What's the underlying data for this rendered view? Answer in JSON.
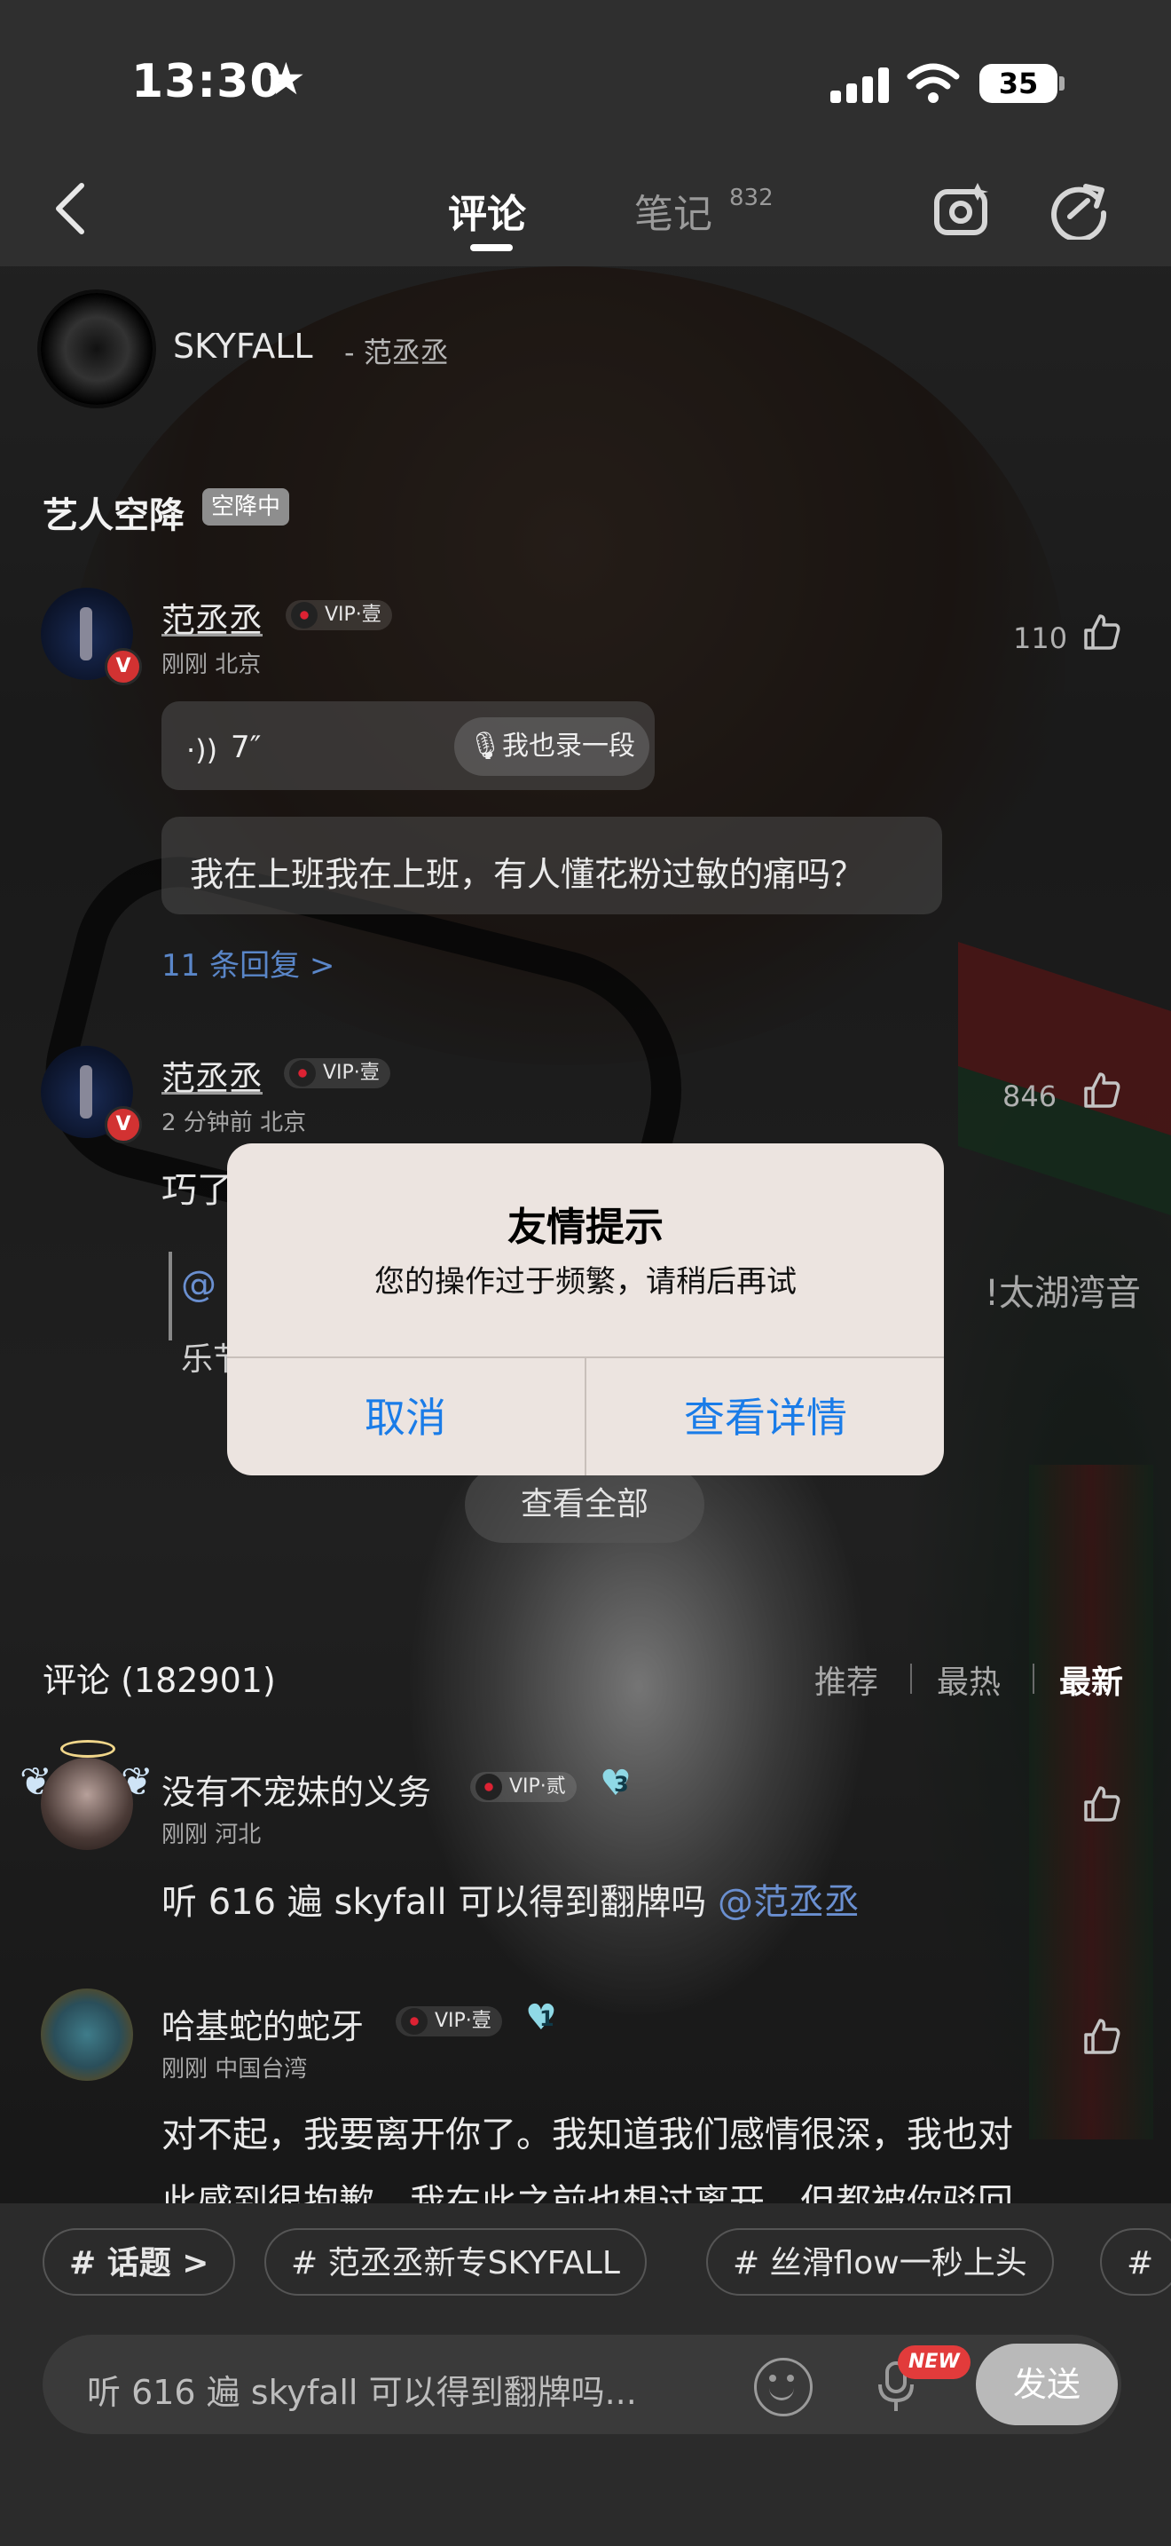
{
  "status": {
    "time": "13:30",
    "battery": "35"
  },
  "header": {
    "tabs": [
      {
        "label": "评论"
      },
      {
        "label": "笔记"
      }
    ],
    "notes_count": "832"
  },
  "song": {
    "title": "SKYFALL",
    "artist": "- 范丞丞"
  },
  "artist_section": {
    "label": "艺人空降",
    "badge": "空降中"
  },
  "artist_comments": [
    {
      "user": "范丞丞",
      "vip": "VIP·壹",
      "meta": "刚刚 北京",
      "likes": "110",
      "voice_duration": "7″",
      "record_label": "我也录一段",
      "text": "我在上班我在上班，有人懂花粉过敏的痛吗？",
      "replies": "11 条回复 >"
    },
    {
      "user": "范丞丞",
      "vip": "VIP·壹",
      "meta": "2 分钟前 北京",
      "likes": "846",
      "text_partial": "巧了",
      "reply_at_partial": "@",
      "reply_tail_partial": "乐节",
      "reply_right_partial": "!太湖湾音"
    }
  ],
  "view_all": "查看全部",
  "alert": {
    "title": "友情提示",
    "message": "您的操作过于频繁，请稍后再试",
    "cancel": "取消",
    "details": "查看详情"
  },
  "comments_header": {
    "count_label": "评论 (182901)",
    "sort": [
      "推荐",
      "最热",
      "最新"
    ],
    "active_sort": "最新"
  },
  "comments": [
    {
      "user": "没有不宠妹的义务",
      "vip": "VIP·贰",
      "fan_level": "3",
      "meta": "刚刚 河北",
      "text": "听 616 遍 skyfall 可以得到翻牌吗 ",
      "mention": "@范丞丞"
    },
    {
      "user": "哈基蛇的蛇牙",
      "vip": "VIP·壹",
      "fan_level": "1",
      "meta": "刚刚 中国台湾",
      "text_line1": "对不起，我要离开你了。我知道我们感情很深，我也对",
      "text_line2": "此感到很抱歉，我在此之前也想过离开，但都被你驳回"
    }
  ],
  "topic_chips": [
    {
      "label": "话题 >"
    },
    {
      "label": "# 范丞丞新专SKYFALL"
    },
    {
      "label": "# 丝滑flow一秒上头"
    },
    {
      "label": "#"
    }
  ],
  "composer": {
    "draft": "听 616 遍 skyfall 可以得到翻牌吗...",
    "new_badge": "NEW",
    "send": "发送"
  },
  "colors": {
    "link": "#6a8fd0",
    "alert_button": "#1a7ce8",
    "vip_badge": "#d23232"
  }
}
